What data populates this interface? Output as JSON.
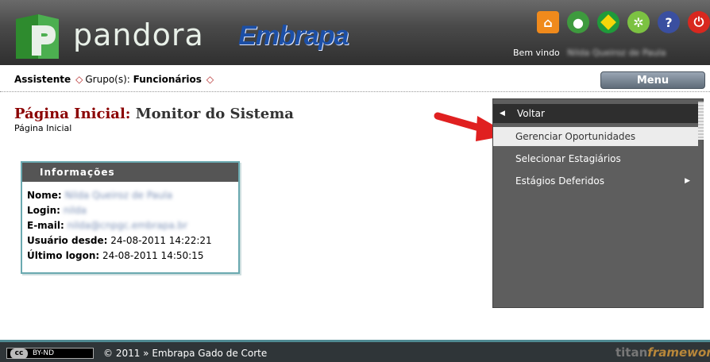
{
  "header": {
    "logo_text": "pandora",
    "brand_text": "Embrapa",
    "welcome_label": "Bem vindo",
    "welcome_user": "Nilda Queiroz de Paula",
    "icons": [
      "home-icon",
      "user-icon",
      "brazil-flag-icon",
      "settings-icon",
      "help-icon",
      "power-icon"
    ]
  },
  "breadcrumb": {
    "role": "Assistente",
    "group_label": "Grupo(s):",
    "group_value": "Funcionários",
    "menu_button": "Menu"
  },
  "page": {
    "title_label": "Página Inicial:",
    "title_value": "Monitor do Sistema",
    "subtitle": "Página Inicial"
  },
  "info": {
    "heading": "Informações",
    "name_label": "Nome:",
    "name_value": "Nilda Queiroz de Paula",
    "login_label": "Login:",
    "login_value": "nilda",
    "email_label": "E-mail:",
    "email_value": "nilda@cnpgc.embrapa.br",
    "since_label": "Usuário desde:",
    "since_value": "24-08-2011 14:22:21",
    "last_label": "Último logon:",
    "last_value": "24-08-2011 14:50:15"
  },
  "menu": {
    "back": "Voltar",
    "items": [
      "Gerenciar Oportunidades",
      "Selecionar Estagiários",
      "Estágios Deferidos"
    ]
  },
  "footer": {
    "license": "BY-ND",
    "copyright": "© 2011 » Embrapa Gado de Corte",
    "framework_a": "titan",
    "framework_b": "framework"
  },
  "colors": {
    "accent": "#1c4fa6",
    "title_red": "#8b0000",
    "info_border": "#6aa9b0",
    "panel_bg": "#5e5e5e"
  }
}
